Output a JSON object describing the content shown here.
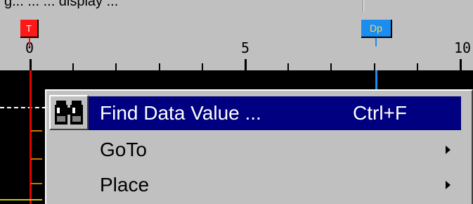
{
  "top_strip": {
    "text": "g... ... ... display ..."
  },
  "ruler": {
    "ticks_major": [
      {
        "label": "0"
      },
      {
        "label": "5"
      },
      {
        "label": "10"
      }
    ]
  },
  "markers": {
    "t_label": "T",
    "dp_label": "Dp"
  },
  "menu": {
    "items": [
      {
        "label": "Find Data Value ...",
        "shortcut": "Ctrl+F",
        "icon": "binoculars-icon",
        "highlighted": true
      },
      {
        "label": "GoTo",
        "submenu": true
      },
      {
        "label": "Place",
        "submenu": true
      }
    ]
  },
  "colors": {
    "background": "#c0c0c0",
    "highlight": "#000080",
    "marker_t": "#ff1818",
    "marker_dp": "#1b8cf0",
    "trace_bg": "#000000"
  }
}
